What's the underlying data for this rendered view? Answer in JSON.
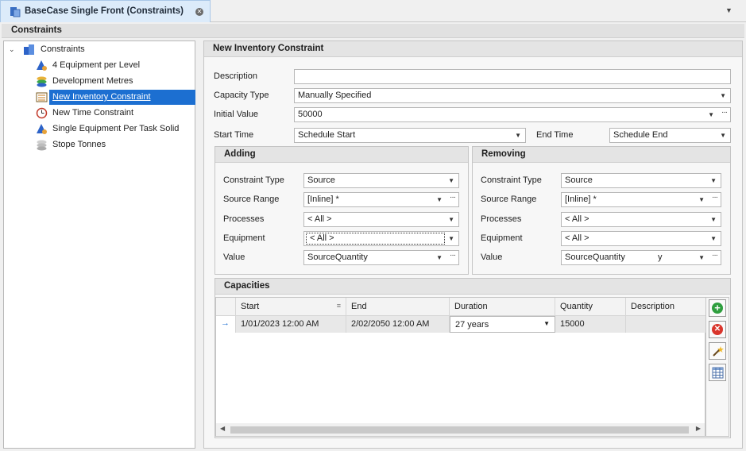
{
  "tab": {
    "title": "BaseCase Single Front (Constraints)"
  },
  "header": {
    "title": "Constraints"
  },
  "tree": {
    "root": "Constraints",
    "items": [
      {
        "label": "4 Equipment per Level",
        "icon": "equipment-constraint-icon"
      },
      {
        "label": "Development Metres",
        "icon": "stacked-coins-icon"
      },
      {
        "label": "New Inventory Constraint",
        "icon": "inventory-constraint-icon",
        "selected": true
      },
      {
        "label": "New Time Constraint",
        "icon": "time-constraint-icon"
      },
      {
        "label": "Single Equipment Per Task Solid",
        "icon": "equipment-constraint-icon"
      },
      {
        "label": "Stope Tonnes",
        "icon": "stacked-coins-grey-icon"
      }
    ]
  },
  "form": {
    "title": "New Inventory Constraint",
    "description_label": "Description",
    "description_value": "",
    "capacity_type_label": "Capacity Type",
    "capacity_type_value": "Manually Specified",
    "initial_value_label": "Initial Value",
    "initial_value_value": "50000",
    "start_time_label": "Start Time",
    "start_time_value": "Schedule Start",
    "end_time_label": "End Time",
    "end_time_value": "Schedule End"
  },
  "adding": {
    "title": "Adding",
    "constraint_type_label": "Constraint Type",
    "constraint_type_value": "Source",
    "source_range_label": "Source Range",
    "source_range_value": "[Inline] *",
    "processes_label": "Processes",
    "processes_value": "< All >",
    "equipment_label": "Equipment",
    "equipment_value": "< All >",
    "value_label": "Value",
    "value_value": "SourceQuantity"
  },
  "removing": {
    "title": "Removing",
    "constraint_type_label": "Constraint Type",
    "constraint_type_value": "Source",
    "source_range_label": "Source Range",
    "source_range_value": "[Inline] *",
    "processes_label": "Processes",
    "processes_value": "< All >",
    "equipment_label": "Equipment",
    "equipment_value": "< All >",
    "value_label": "Value",
    "value_value": "SourceQuantity",
    "value_suffix": "y"
  },
  "capacities": {
    "title": "Capacities",
    "columns": [
      "Start",
      "End",
      "Duration",
      "Quantity",
      "Description"
    ],
    "rows": [
      {
        "start": "1/01/2023 12:00 AM",
        "end": "2/02/2050 12:00 AM",
        "duration": "27 years",
        "quantity": "15000",
        "description": ""
      }
    ]
  },
  "colors": {
    "selection": "#1c6fd1",
    "add": "#2e9e3e",
    "remove": "#d9352c"
  }
}
